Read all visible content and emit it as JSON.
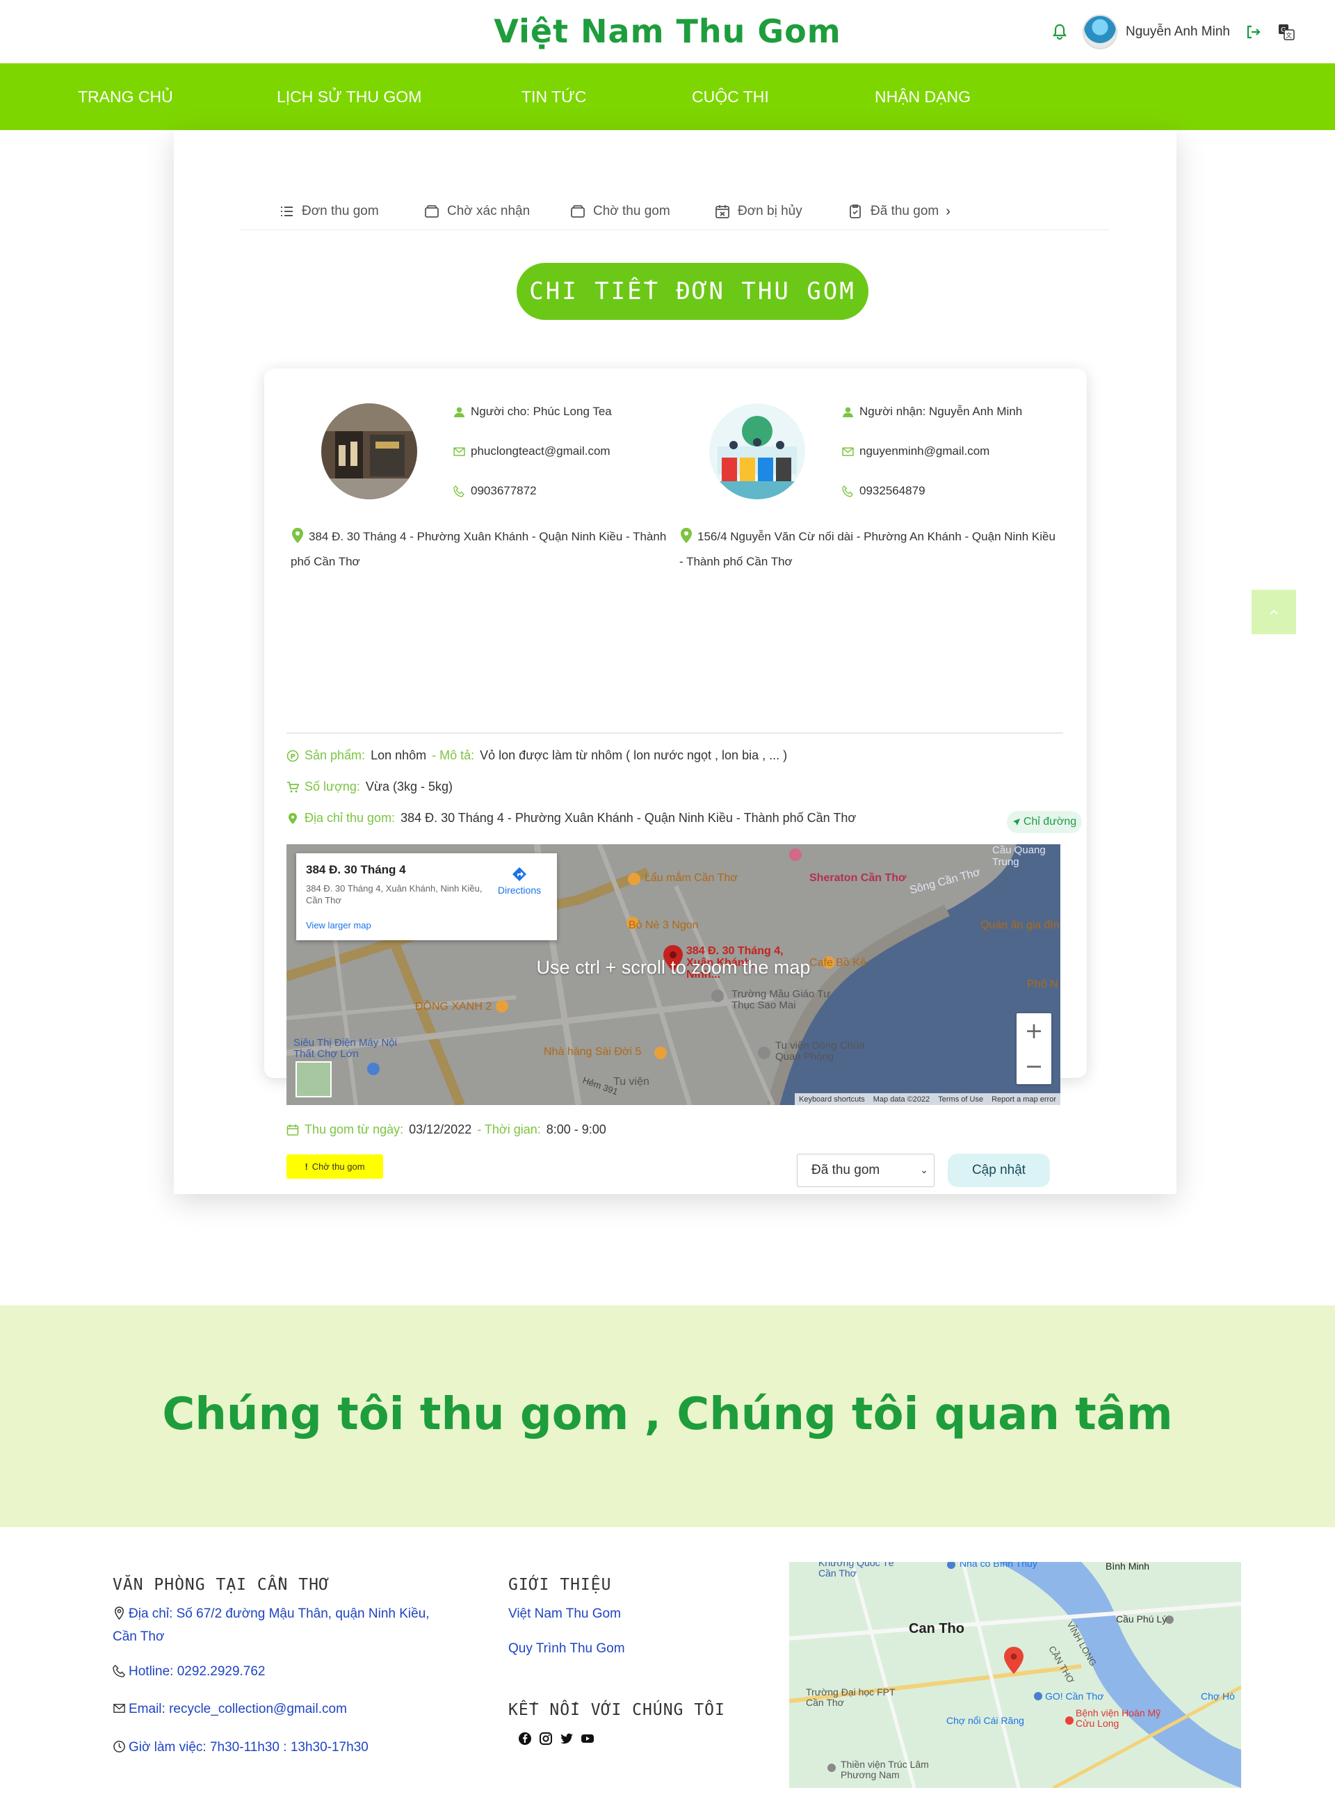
{
  "header": {
    "brand": "Việt Nam Thu Gom",
    "username": "Nguyễn Anh Minh"
  },
  "nav": {
    "items": [
      "TRANG CHỦ",
      "LỊCH SỬ THU GOM",
      "TIN TỨC",
      "CUỘC THI",
      "NHẬN DẠNG"
    ]
  },
  "tabs": [
    "Đơn thu gom",
    "Chờ xác nhận",
    "Chờ thu gom",
    "Đơn bị hủy",
    "Đã thu gom"
  ],
  "page_title": "CHI TIẾT ĐƠN THU GOM",
  "sender": {
    "name": "Người cho: Phúc Long Tea",
    "email": "phuclongteact@gmail.com",
    "phone": "0903677872",
    "address_line1": "384 Đ. 30 Tháng 4 - Phường Xuân Khánh - Quận Ninh Kiều - Thành",
    "address_line2": "phố Cần Thơ"
  },
  "receiver": {
    "name": "Người nhận: Nguyễn Anh Minh",
    "email": "nguyenminh@gmail.com",
    "phone": "0932564879",
    "address_line1": "156/4 Nguyễn Văn Cừ nối dài - Phường An Khánh - Quận Ninh Kiều",
    "address_line2": "- Thành phố Cần Thơ"
  },
  "details": {
    "product_label": "Sản phẩm:",
    "product_value": "Lon nhôm",
    "desc_label": "- Mô tả:",
    "desc_value": "Vỏ lon được làm từ nhôm ( lon nước ngọt , lon bia , ... )",
    "qty_label": "Số lượng:",
    "qty_value": "Vừa (3kg - 5kg)",
    "addr_label": "Địa chỉ thu gom:",
    "addr_value": "384 Đ. 30 Tháng 4 - Phường Xuân Khánh - Quận Ninh Kiều - Thành phố Cần Thơ",
    "directions_btn": "Chỉ đường",
    "date_label": "Thu gom từ ngày:",
    "date_value": "03/12/2022",
    "time_label": "- Thời gian:",
    "time_value": "8:00 - 9:00"
  },
  "map": {
    "popup_title": "384 Đ. 30 Tháng 4",
    "popup_address": "384 Đ. 30 Tháng 4, Xuân Khánh, Ninh Kiều, Cần Thơ",
    "popup_link": "View larger map",
    "directions": "Directions",
    "overlay": "Use ctrl + scroll to zoom the map",
    "pin_label": "384 Đ. 30 Tháng 4, Xuân Khánh, Ninh...",
    "zoom_in": "+",
    "zoom_out": "−",
    "footer": [
      "Keyboard shortcuts",
      "Map data ©2022",
      "Terms of Use",
      "Report a map error"
    ],
    "places": [
      "Lẩu mắm Cần Thơ",
      "Sheraton Cần Thơ",
      "Bò Nè 3 Ngon",
      "ĐỒNG XANH 2",
      "Cafe Bồ Kê",
      "Trường Mầu Giáo Tư Thục Sao Mai",
      "Siêu Thị Điện Máy Nội Thất Chợ Lớn",
      "Nhà hàng Sài Đời 5",
      "Tu viện Dòng Chúa Quan Phòng",
      "Sông Cần Thơ",
      "Quán ăn gia đình",
      "Cầu Quang Trung",
      "Phố N",
      "Tu viện",
      "Hẻm 391"
    ]
  },
  "status": {
    "badge": "Chờ thu gom",
    "select_value": "Đã thu gom",
    "update_btn": "Cập nhật"
  },
  "slogan": "Chúng tôi thu gom , Chúng tôi quan tâm",
  "footer": {
    "office_heading": "VĂN PHÒNG TẠI CẦN THƠ",
    "address_l1": "Địa chỉ: Số 67/2 đường Mậu Thân, quận Ninh Kiều,",
    "address_l2": "Cần Thơ",
    "hotline": "Hotline: 0292.2929.762",
    "email": "Email: recycle_collection@gmail.com",
    "hours": "Giờ làm việc: 7h30-11h30 : 13h30-17h30",
    "about_heading": "GIỚI THIỆU",
    "about_links": [
      "Việt Nam Thu Gom",
      "Quy Trình Thu Gom"
    ],
    "connect_heading": "KẾT NỐI VỚI CHÚNG TÔI",
    "map_labels": [
      "Can Tho",
      "Bình Minh",
      "Trường Đại học FPT Cần Thơ",
      "GO! Cần Thơ",
      "Chợ nổi Cái Răng",
      "Bệnh viện Hoàn Mỹ Cửu Long",
      "Cầu Phú Lý",
      "VĨNH LONG",
      "CẦN THƠ",
      "Thiền viện Trúc Lâm Phương Nam",
      "Khương Quốc Tế Cần Thơ",
      "Nhà cổ Bình Thủy",
      "Chợ Hò"
    ]
  },
  "colors": {
    "brand_green": "#1e9d3c",
    "nav_green": "#7ed600",
    "pill_green": "#6cc817",
    "slogan_bg": "#eaf5cb",
    "badge_yellow": "#ffff00",
    "link_blue": "#1e44c2"
  }
}
